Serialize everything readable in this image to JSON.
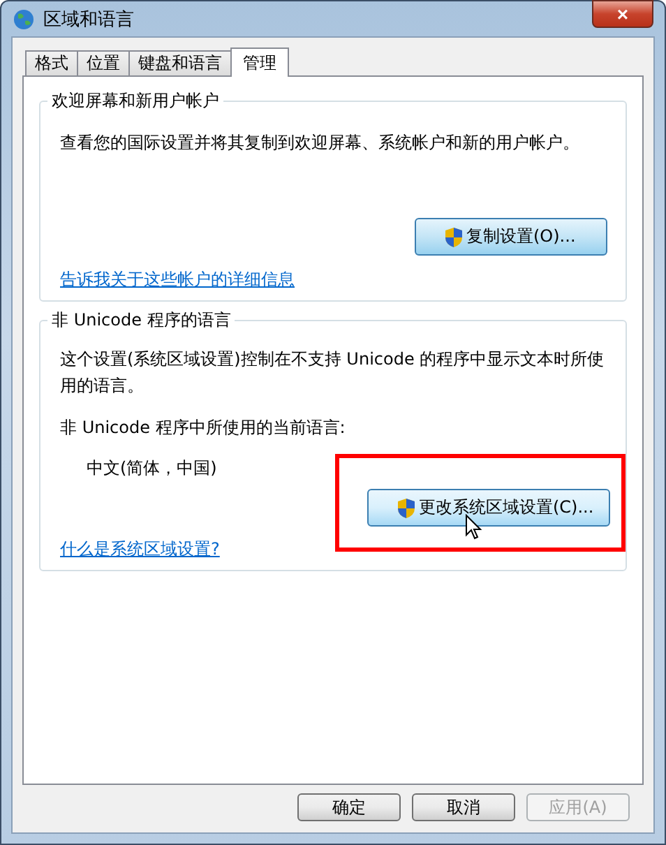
{
  "window": {
    "title": "区域和语言",
    "close": "×"
  },
  "tabs": [
    {
      "label": "格式",
      "selected": false
    },
    {
      "label": "位置",
      "selected": false
    },
    {
      "label": "键盘和语言",
      "selected": false
    },
    {
      "label": "管理",
      "selected": true
    }
  ],
  "groups": [
    {
      "title": "欢迎屏幕和新用户帐户",
      "description": "查看您的国际设置并将其复制到欢迎屏幕、系统帐户和新的用户帐户。",
      "button": {
        "label": "复制设置(O)..."
      },
      "link": "告诉我关于这些帐户的详细信息"
    },
    {
      "title": "非 Unicode 程序的语言",
      "description": "这个设置(系统区域设置)控制在不支持 Unicode 的程序中显示文本时所使用的语言。",
      "current_label": "非 Unicode 程序中所使用的当前语言:",
      "current_value": "中文(简体，中国)",
      "button": {
        "label": "更改系统区域设置(C)...",
        "highlighted": true,
        "hovered": true
      },
      "link": "什么是系统区域设置?"
    }
  ],
  "buttons": [
    {
      "label": "确定",
      "disabled": false
    },
    {
      "label": "取消",
      "disabled": false
    },
    {
      "label": "应用(A)",
      "disabled": true
    }
  ]
}
